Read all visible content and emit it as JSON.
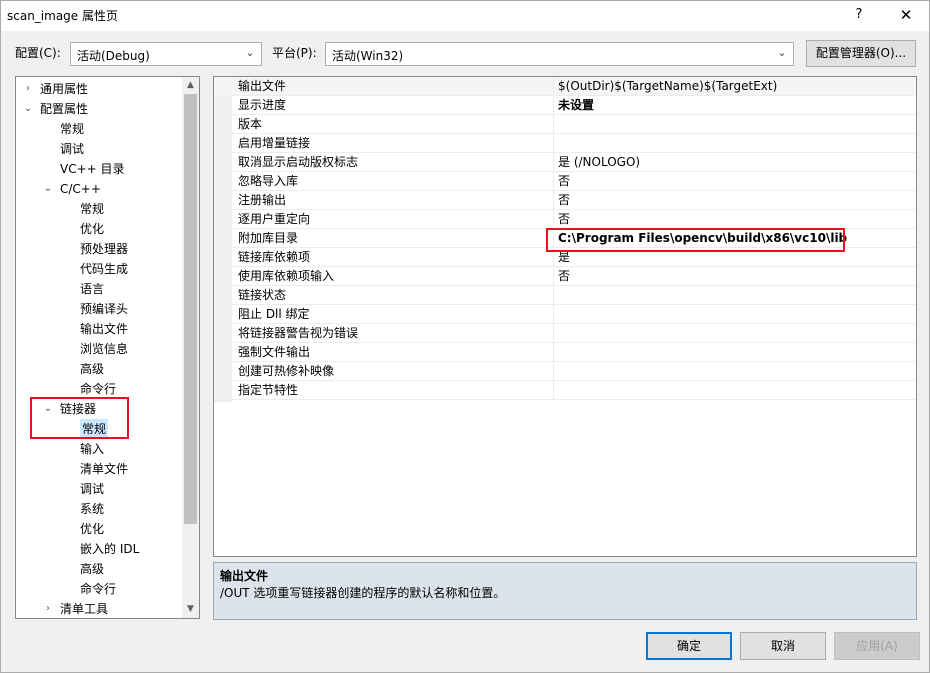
{
  "window": {
    "title": "scan_image 属性页",
    "help": "?",
    "close": "✕"
  },
  "config_bar": {
    "config_label": "配置(C):",
    "config_value": "活动(Debug)",
    "platform_label": "平台(P):",
    "platform_value": "活动(Win32)",
    "manager_button": "配置管理器(O)..."
  },
  "tree": [
    {
      "label": "通用属性",
      "toggle": "›",
      "level": 0
    },
    {
      "label": "配置属性",
      "toggle": "⌄",
      "level": 0
    },
    {
      "label": "常规",
      "level": 1
    },
    {
      "label": "调试",
      "level": 1
    },
    {
      "label": "VC++ 目录",
      "level": 1
    },
    {
      "label": "C/C++",
      "toggle": "⌄",
      "level": 1
    },
    {
      "label": "常规",
      "level": 2
    },
    {
      "label": "优化",
      "level": 2
    },
    {
      "label": "预处理器",
      "level": 2
    },
    {
      "label": "代码生成",
      "level": 2
    },
    {
      "label": "语言",
      "level": 2
    },
    {
      "label": "预编译头",
      "level": 2
    },
    {
      "label": "输出文件",
      "level": 2
    },
    {
      "label": "浏览信息",
      "level": 2
    },
    {
      "label": "高级",
      "level": 2
    },
    {
      "label": "命令行",
      "level": 2
    },
    {
      "label": "链接器",
      "toggle": "⌄",
      "level": 1
    },
    {
      "label": "常规",
      "level": 2,
      "selected": true
    },
    {
      "label": "输入",
      "level": 2
    },
    {
      "label": "清单文件",
      "level": 2
    },
    {
      "label": "调试",
      "level": 2
    },
    {
      "label": "系统",
      "level": 2
    },
    {
      "label": "优化",
      "level": 2
    },
    {
      "label": "嵌入的 IDL",
      "level": 2
    },
    {
      "label": "高级",
      "level": 2
    },
    {
      "label": "命令行",
      "level": 2
    },
    {
      "label": "清单工具",
      "toggle": "›",
      "level": 1
    }
  ],
  "properties": [
    {
      "name": "输出文件",
      "value": "$(OutDir)$(TargetName)$(TargetExt)",
      "bold": false
    },
    {
      "name": "显示进度",
      "value": "未设置",
      "bold": true
    },
    {
      "name": "版本",
      "value": "",
      "bold": false
    },
    {
      "name": "启用增量链接",
      "value": "",
      "bold": false
    },
    {
      "name": "取消显示启动版权标志",
      "value": "是 (/NOLOGO)",
      "bold": false
    },
    {
      "name": "忽略导入库",
      "value": "否",
      "bold": false
    },
    {
      "name": "注册输出",
      "value": "否",
      "bold": false
    },
    {
      "name": "逐用户重定向",
      "value": "否",
      "bold": false
    },
    {
      "name": "附加库目录",
      "value": "C:\\Program Files\\opencv\\build\\x86\\vc10\\lib",
      "bold": true
    },
    {
      "name": "链接库依赖项",
      "value": "是",
      "bold": false
    },
    {
      "name": "使用库依赖项输入",
      "value": "否",
      "bold": false
    },
    {
      "name": "链接状态",
      "value": "",
      "bold": false
    },
    {
      "name": "阻止 Dll 绑定",
      "value": "",
      "bold": false
    },
    {
      "name": "将链接器警告视为错误",
      "value": "",
      "bold": false
    },
    {
      "name": "强制文件输出",
      "value": "",
      "bold": false
    },
    {
      "name": "创建可热修补映像",
      "value": "",
      "bold": false
    },
    {
      "name": "指定节特性",
      "value": "",
      "bold": false
    }
  ],
  "description": {
    "title": "输出文件",
    "text": "/OUT 选项重写链接器创建的程序的默认名称和位置。"
  },
  "buttons": {
    "ok": "确定",
    "cancel": "取消",
    "apply": "应用(A)"
  },
  "colors": {
    "highlight_box": "#e81123",
    "selection": "#cce8ff",
    "primary_border": "#0078d7"
  }
}
